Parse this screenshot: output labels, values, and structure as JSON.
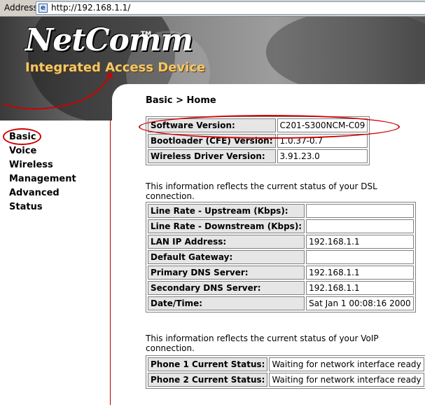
{
  "browser": {
    "address_label": "Address",
    "url": "http://192.168.1.1/"
  },
  "header": {
    "brand": "NetComm",
    "trademark": "TM",
    "tagline": "Integrated Access Device"
  },
  "sidebar": {
    "items": [
      {
        "label": "Basic"
      },
      {
        "label": "Voice"
      },
      {
        "label": "Wireless"
      },
      {
        "label": "Management"
      },
      {
        "label": "Advanced"
      },
      {
        "label": "Status"
      }
    ]
  },
  "main": {
    "breadcrumb": "Basic > Home",
    "version_table": [
      {
        "label": "Software Version:",
        "value": "C201-S300NCM-C09"
      },
      {
        "label": "Bootloader (CFE) Version:",
        "value": "1.0.37-0.7"
      },
      {
        "label": "Wireless Driver Version:",
        "value": "3.91.23.0"
      }
    ],
    "dsl_note": "This information reflects the current status of your DSL connection.",
    "dsl_table": [
      {
        "label": "Line Rate - Upstream (Kbps):",
        "value": ""
      },
      {
        "label": "Line Rate - Downstream (Kbps):",
        "value": ""
      },
      {
        "label": "LAN IP Address:",
        "value": "192.168.1.1"
      },
      {
        "label": "Default Gateway:",
        "value": ""
      },
      {
        "label": "Primary DNS Server:",
        "value": "192.168.1.1"
      },
      {
        "label": "Secondary DNS Server:",
        "value": "192.168.1.1"
      },
      {
        "label": "Date/Time:",
        "value": "Sat Jan 1 00:08:16 2000"
      }
    ],
    "voip_note": "This information reflects the current status of your VoIP connection.",
    "voip_table": [
      {
        "label": "Phone 1 Current Status:",
        "value": "Waiting for network interface ready"
      },
      {
        "label": "Phone 2 Current Status:",
        "value": "Waiting for network interface ready"
      }
    ]
  },
  "colors": {
    "annotation_red": "#d00000",
    "label_bg": "#e6e6e6",
    "tagline": "#f4c76a"
  }
}
